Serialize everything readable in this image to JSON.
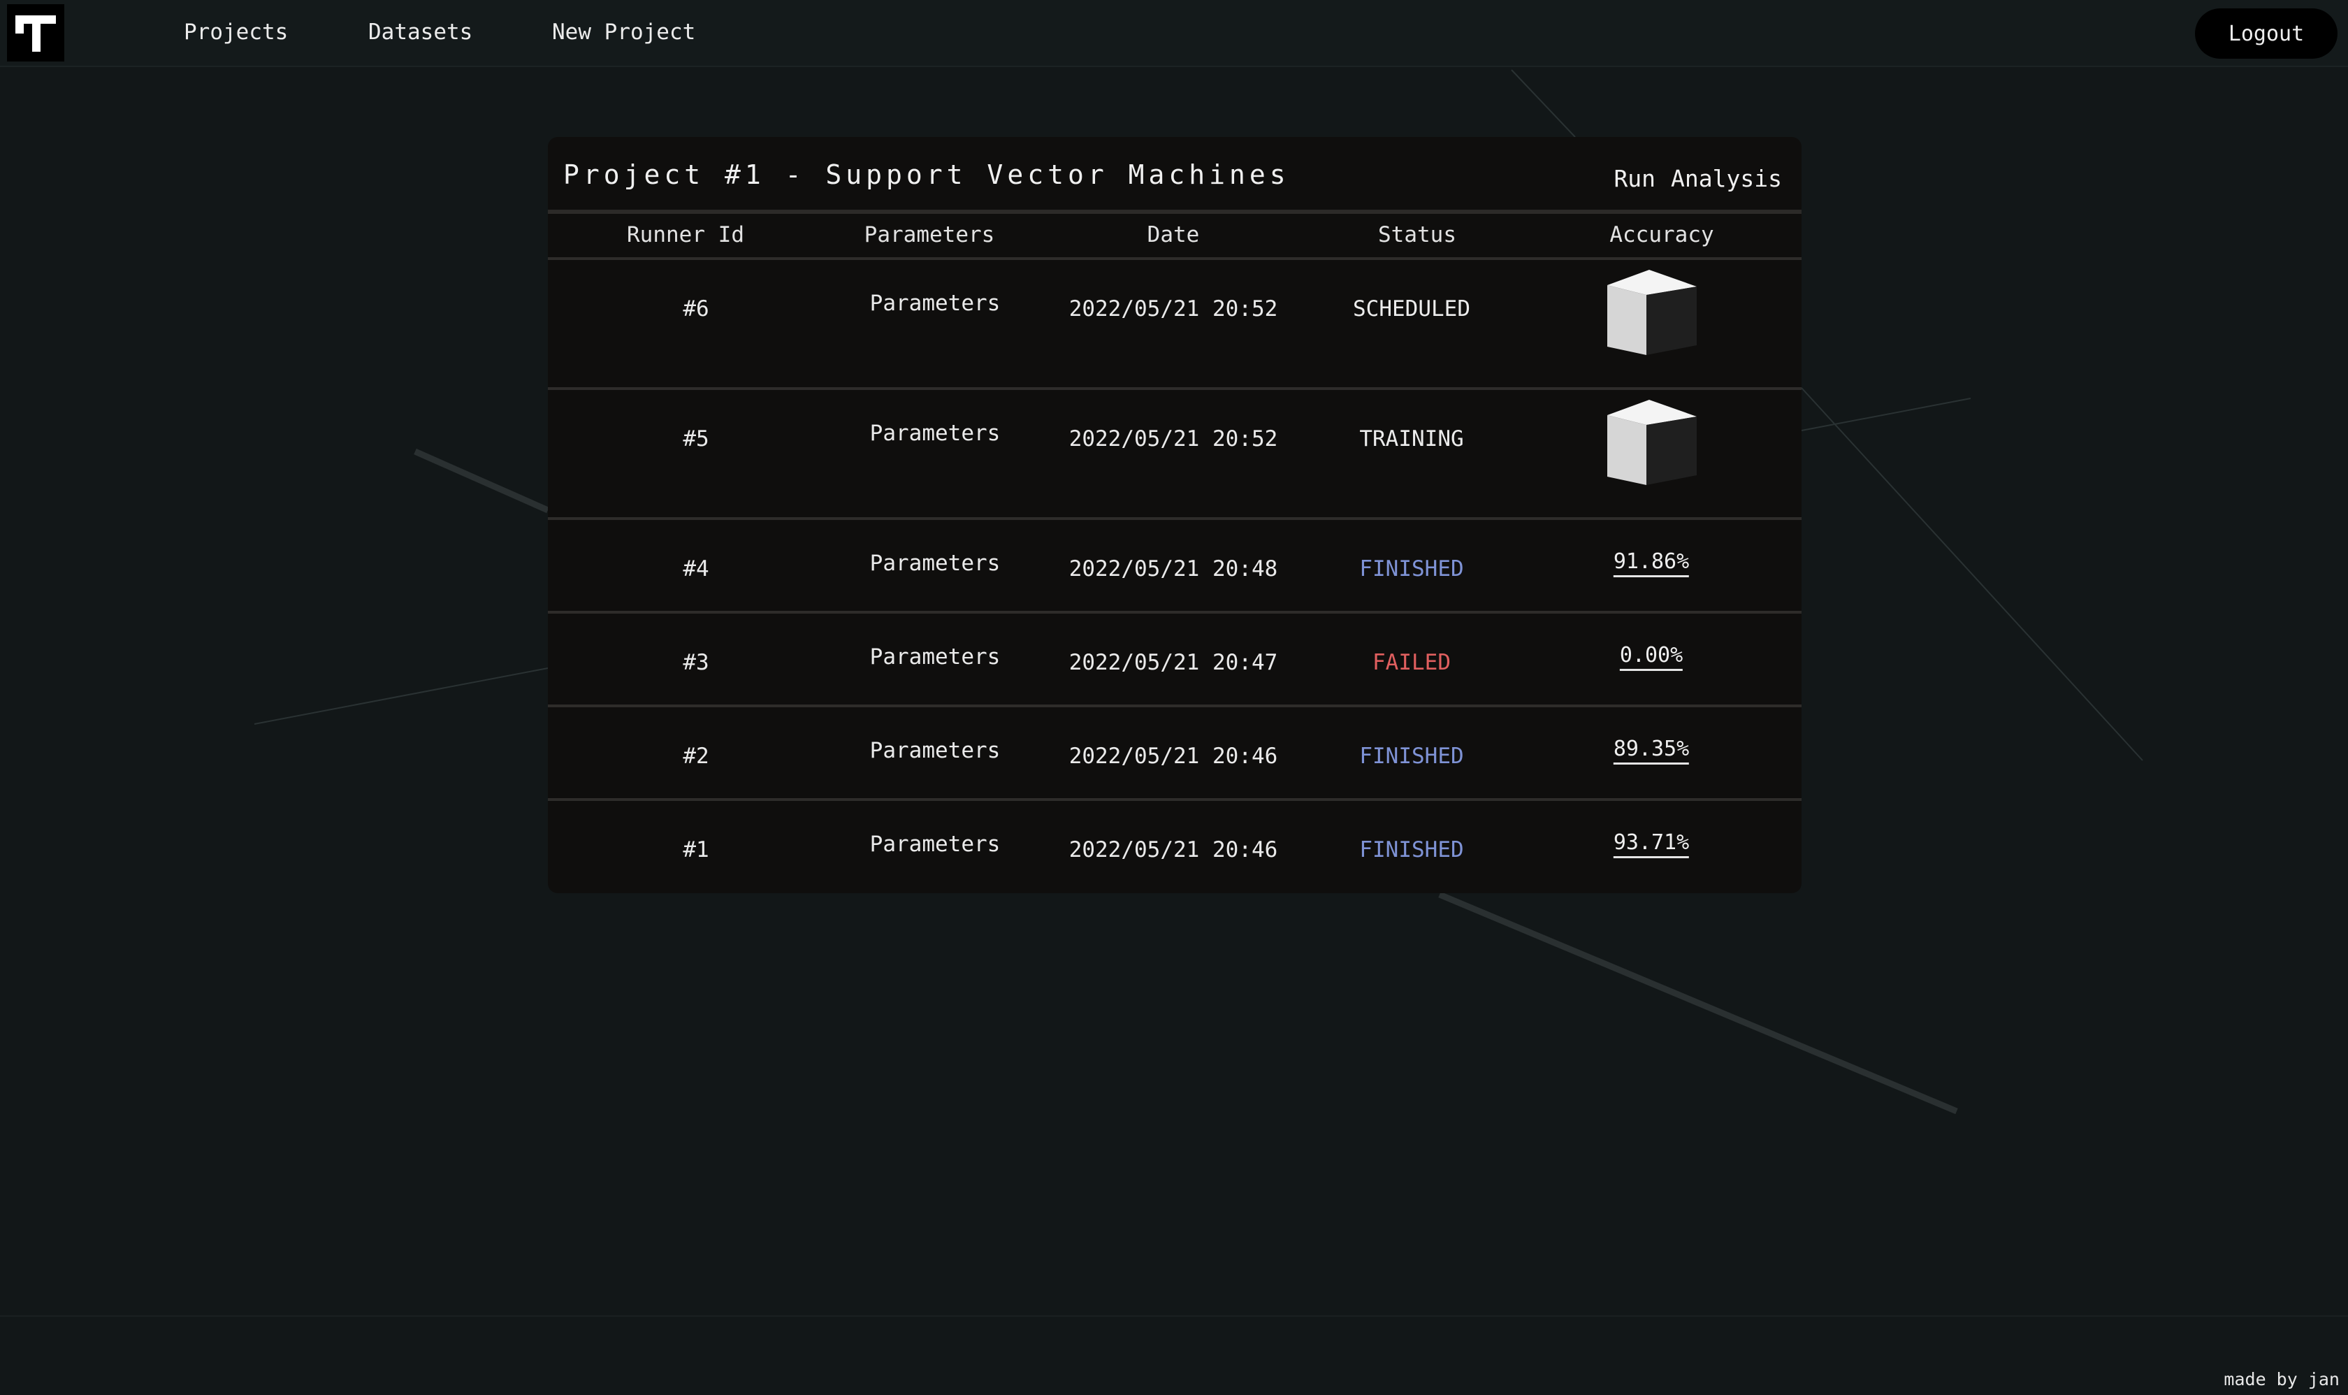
{
  "nav": {
    "logo_letter": "T",
    "links": [
      "Projects",
      "Datasets",
      "New Project"
    ],
    "logout_label": "Logout"
  },
  "project": {
    "title": "Project #1 - Support Vector Machines",
    "actions": [
      "Run",
      "Analysis"
    ]
  },
  "table": {
    "columns": [
      "Runner Id",
      "Parameters",
      "Date",
      "Status",
      "Accuracy"
    ],
    "rows": [
      {
        "id": "#6",
        "parameters": "Parameters",
        "date": "2022/05/21 20:52",
        "status": "SCHEDULED",
        "accuracy": null,
        "accuracy_icon": "loading-cube-icon"
      },
      {
        "id": "#5",
        "parameters": "Parameters",
        "date": "2022/05/21 20:52",
        "status": "TRAINING",
        "accuracy": null,
        "accuracy_icon": "loading-cube-icon"
      },
      {
        "id": "#4",
        "parameters": "Parameters",
        "date": "2022/05/21 20:48",
        "status": "FINISHED",
        "accuracy": "91.86%"
      },
      {
        "id": "#3",
        "parameters": "Parameters",
        "date": "2022/05/21 20:47",
        "status": "FAILED",
        "accuracy": "0.00%"
      },
      {
        "id": "#2",
        "parameters": "Parameters",
        "date": "2022/05/21 20:46",
        "status": "FINISHED",
        "accuracy": "89.35%"
      },
      {
        "id": "#1",
        "parameters": "Parameters",
        "date": "2022/05/21 20:46",
        "status": "FINISHED",
        "accuracy": "93.71%"
      }
    ]
  },
  "status_colors": {
    "FINISHED": "#7f93d6",
    "FAILED": "#e05f5f",
    "SCHEDULED": "#ececec",
    "TRAINING": "#ececec"
  },
  "footer": {
    "credit": "made by jan"
  }
}
